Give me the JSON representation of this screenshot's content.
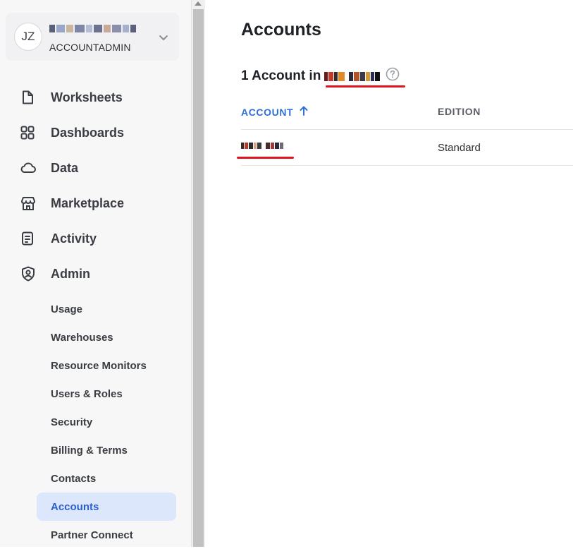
{
  "user": {
    "initials": "JZ",
    "role": "ACCOUNTADMIN"
  },
  "nav": {
    "items": [
      {
        "label": "Worksheets",
        "icon": "document-icon"
      },
      {
        "label": "Dashboards",
        "icon": "grid-icon"
      },
      {
        "label": "Data",
        "icon": "cloud-icon"
      },
      {
        "label": "Marketplace",
        "icon": "storefront-icon"
      },
      {
        "label": "Activity",
        "icon": "clipboard-icon"
      },
      {
        "label": "Admin",
        "icon": "shield-user-icon"
      }
    ],
    "admin_subitems": [
      {
        "label": "Usage"
      },
      {
        "label": "Warehouses"
      },
      {
        "label": "Resource Monitors"
      },
      {
        "label": "Users & Roles"
      },
      {
        "label": "Security"
      },
      {
        "label": "Billing & Terms"
      },
      {
        "label": "Contacts"
      },
      {
        "label": "Accounts",
        "active": true
      },
      {
        "label": "Partner Connect"
      }
    ]
  },
  "main": {
    "title": "Accounts",
    "count_text": "1 Account in",
    "table": {
      "headers": [
        "ACCOUNT",
        "EDITION"
      ],
      "rows": [
        {
          "edition": "Standard"
        }
      ]
    }
  },
  "colors": {
    "accent": "#2f6fd6",
    "active_bg": "#dde7fb",
    "annotation_red": "#e0141e"
  }
}
